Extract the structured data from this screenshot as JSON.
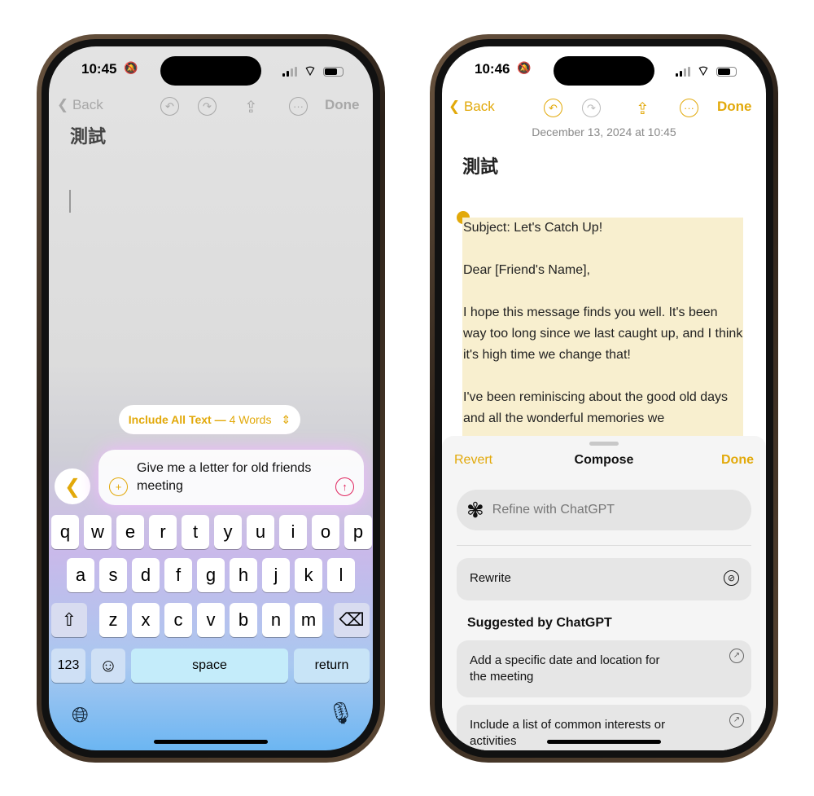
{
  "left": {
    "status": {
      "time": "10:45"
    },
    "nav": {
      "back": "Back",
      "done": "Done"
    },
    "note_title": "測試",
    "scope_pill": {
      "label": "Include All Text —",
      "count": "4 Words"
    },
    "prompt": {
      "text": "Give me a letter for old friends meeting"
    },
    "keyboard": {
      "row1": [
        "q",
        "w",
        "e",
        "r",
        "t",
        "y",
        "u",
        "i",
        "o",
        "p"
      ],
      "row2": [
        "a",
        "s",
        "d",
        "f",
        "g",
        "h",
        "j",
        "k",
        "l"
      ],
      "row3": [
        "z",
        "x",
        "c",
        "v",
        "b",
        "n",
        "m"
      ],
      "numbers": "123",
      "space": "space",
      "return": "return"
    }
  },
  "right": {
    "status": {
      "time": "10:46"
    },
    "nav": {
      "back": "Back",
      "done": "Done"
    },
    "date": "December 13, 2024 at 10:45",
    "note_title": "測試",
    "body": [
      "Subject: Let's Catch Up!",
      "Dear [Friend's Name],",
      "I hope this message finds you well. It's been way too long since we last caught up, and I think it's high time we change that!",
      "I've been reminiscing about the good old days and all the wonderful memories we"
    ],
    "sheet": {
      "revert": "Revert",
      "title": "Compose",
      "done": "Done",
      "refine_placeholder": "Refine with ChatGPT",
      "rewrite": "Rewrite",
      "suggested_header": "Suggested by ChatGPT",
      "suggestions": [
        "Add a specific date and location for the meeting",
        "Include a list of common interests or activities"
      ]
    }
  },
  "colors": {
    "accent": "#e2a90a",
    "highlight": "#f8efcf"
  }
}
